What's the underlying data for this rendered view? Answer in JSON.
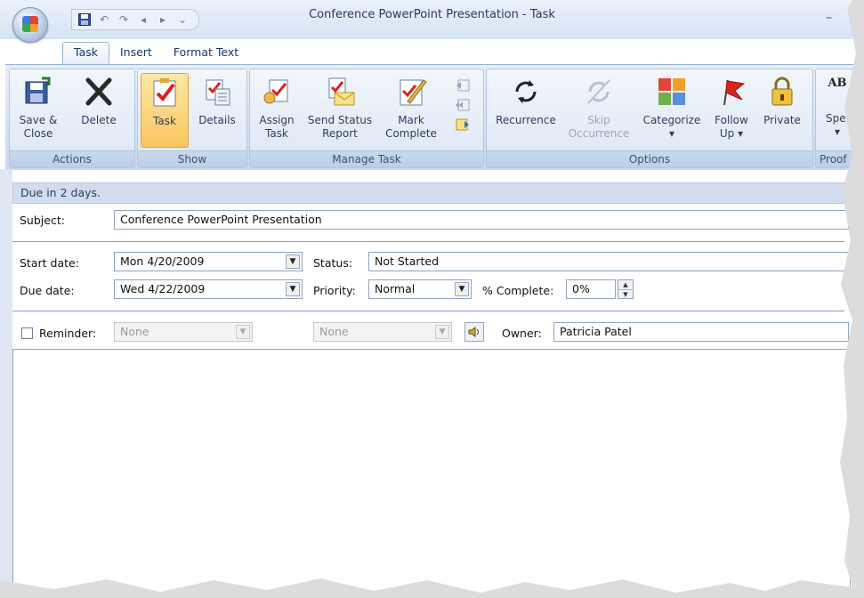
{
  "window": {
    "title": "Conference PowerPoint Presentation - Task",
    "minimize_glyph": "–"
  },
  "qat": {
    "items": [
      "save-icon",
      "undo-icon",
      "redo-icon",
      "previous-item-icon",
      "next-item-icon",
      "customize-qat-icon"
    ]
  },
  "tabs": [
    "Task",
    "Insert",
    "Format Text"
  ],
  "ribbon": {
    "groups": {
      "actions": "Actions",
      "show": "Show",
      "manage": "Manage Task",
      "options": "Options",
      "proofing": "Proof"
    },
    "buttons": {
      "save_close": [
        "Save &",
        "Close"
      ],
      "delete": "Delete",
      "task": "Task",
      "details": "Details",
      "assign": [
        "Assign",
        "Task"
      ],
      "send_status": [
        "Send Status",
        "Report"
      ],
      "mark_complete": [
        "Mark",
        "Complete"
      ],
      "recurrence": "Recurrence",
      "skip": [
        "Skip",
        "Occurrence"
      ],
      "categorize": [
        "Categorize",
        "▾"
      ],
      "follow_up": [
        "Follow",
        "Up ▾"
      ],
      "private": "Private",
      "spelling": [
        "Spel",
        "▾"
      ],
      "spelling_top": "AB"
    },
    "colors": {
      "pressed": "#f8c660",
      "flag": "#d9231f"
    }
  },
  "infobar": {
    "text": "Due in 2 days."
  },
  "form": {
    "subject_label": "Subject:",
    "subject_value": "Conference PowerPoint Presentation",
    "start_label": "Start date:",
    "start_value": "Mon 4/20/2009",
    "due_label": "Due date:",
    "due_value": "Wed 4/22/2009",
    "status_label": "Status:",
    "status_value": "Not Started",
    "priority_label": "Priority:",
    "priority_value": "Normal",
    "complete_label": "% Complete:",
    "complete_value": "0%",
    "reminder_label": "Reminder:",
    "reminder_checked": false,
    "reminder_date": "None",
    "reminder_time": "None",
    "owner_label": "Owner:",
    "owner_value": "Patricia Patel",
    "sound_icon": "speaker-icon"
  }
}
